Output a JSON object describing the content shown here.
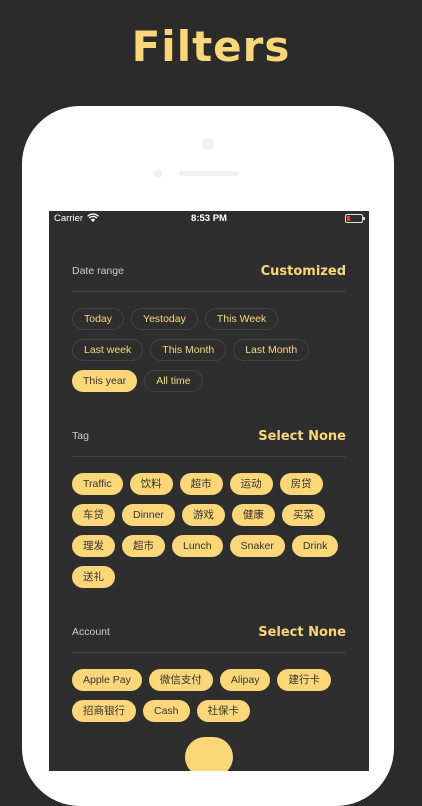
{
  "promo": {
    "title": "Filters"
  },
  "status_bar": {
    "carrier": "Carrier",
    "time": "8:53 PM"
  },
  "date_range": {
    "label": "Date range",
    "action": "Customized",
    "chips": [
      {
        "label": "Today",
        "selected": false
      },
      {
        "label": "Yestoday",
        "selected": false
      },
      {
        "label": "This Week",
        "selected": false
      },
      {
        "label": "Last week",
        "selected": false
      },
      {
        "label": "This Month",
        "selected": false
      },
      {
        "label": "Last Month",
        "selected": false
      },
      {
        "label": "This year",
        "selected": true
      },
      {
        "label": "All time",
        "selected": false
      }
    ]
  },
  "tag": {
    "label": "Tag",
    "action": "Select None",
    "chips": [
      {
        "label": "Traffic",
        "selected": true
      },
      {
        "label": "饮料",
        "selected": true
      },
      {
        "label": "超市",
        "selected": true
      },
      {
        "label": "运动",
        "selected": true
      },
      {
        "label": "房贷",
        "selected": true
      },
      {
        "label": "车贷",
        "selected": true
      },
      {
        "label": "Dinner",
        "selected": true
      },
      {
        "label": "游戏",
        "selected": true
      },
      {
        "label": "健康",
        "selected": true
      },
      {
        "label": "买菜",
        "selected": true
      },
      {
        "label": "理发",
        "selected": true
      },
      {
        "label": "超市",
        "selected": true
      },
      {
        "label": "Lunch",
        "selected": true
      },
      {
        "label": "Snaker",
        "selected": true
      },
      {
        "label": "Drink",
        "selected": true
      },
      {
        "label": "送礼",
        "selected": true
      }
    ]
  },
  "account": {
    "label": "Account",
    "action": "Select None",
    "chips": [
      {
        "label": "Apple Pay",
        "selected": true
      },
      {
        "label": "微信支付",
        "selected": true
      },
      {
        "label": "Alipay",
        "selected": true
      },
      {
        "label": "建行卡",
        "selected": true
      },
      {
        "label": "招商银行",
        "selected": true
      },
      {
        "label": "Cash",
        "selected": true
      },
      {
        "label": "社保卡",
        "selected": true
      }
    ]
  },
  "colors": {
    "accent": "#fcd77a",
    "background": "#2b2b2b",
    "screen": "#2e2e2e"
  }
}
